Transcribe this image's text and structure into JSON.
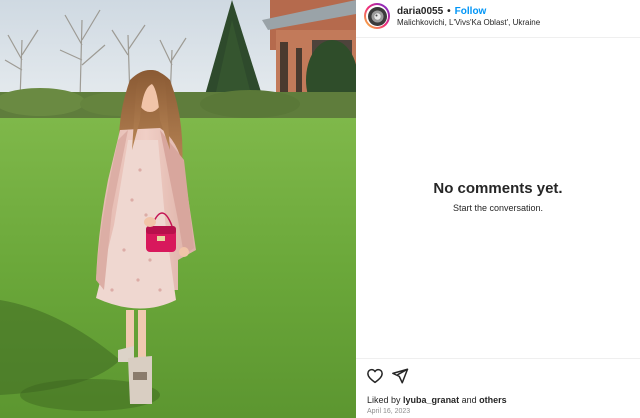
{
  "post": {
    "username": "daria0055",
    "separator": "•",
    "follow_label": "Follow",
    "location": "Malichkovichi, L'Vivs'Ka Oblast', Ukraine",
    "avatar_icon": "profile-avatar"
  },
  "comments": {
    "empty_title": "No comments yet.",
    "empty_subtitle": "Start the conversation."
  },
  "actions": {
    "like_icon": "heart-icon",
    "share_icon": "send-icon"
  },
  "likes": {
    "prefix": "Liked by",
    "user": "lyuba_granat",
    "conjunction": "and",
    "others": "others"
  },
  "date": "April 16, 2023",
  "colors": {
    "follow_blue": "#0095f6",
    "text": "#262626",
    "muted": "#8e8e8e",
    "divider": "#efefef"
  }
}
